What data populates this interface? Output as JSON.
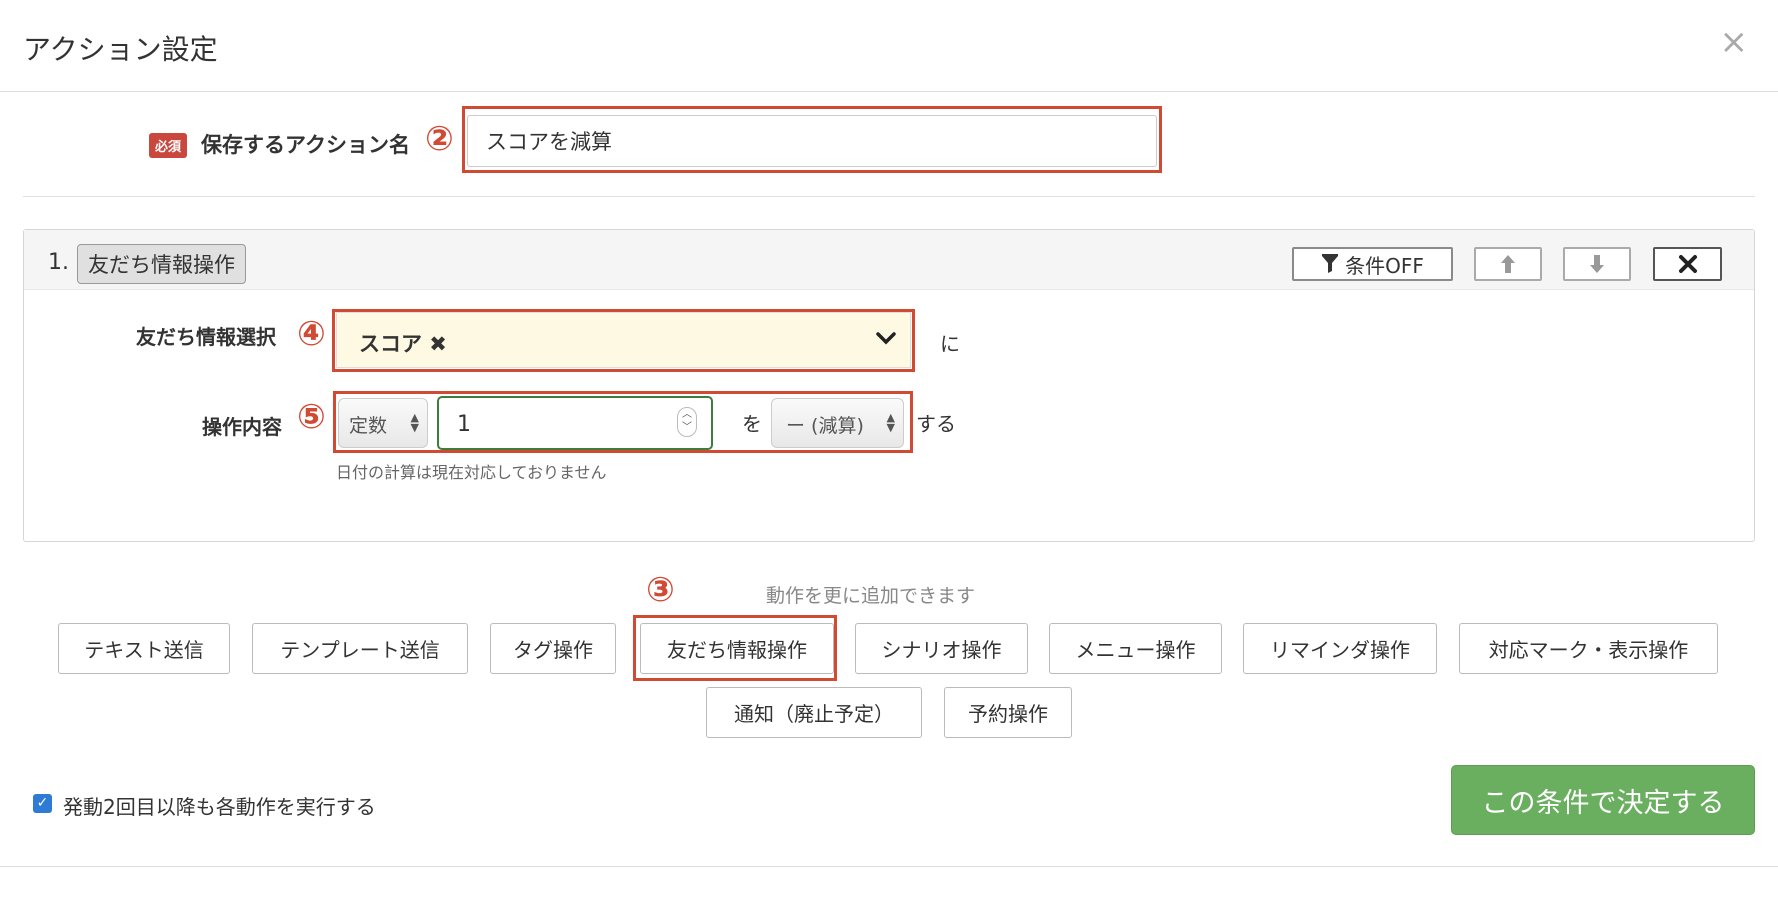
{
  "header": {
    "title": "アクション設定",
    "close_icon": "×"
  },
  "name_field": {
    "required_badge": "必須",
    "label": "保存するアクション名",
    "marker": "②",
    "value": "スコアを減算"
  },
  "action": {
    "index": "1.",
    "type_tag": "友だち情報操作",
    "condition_button": "条件OFF",
    "friend_info": {
      "label": "友だち情報選択",
      "marker": "④",
      "selected": "スコア ✖",
      "suffix": "に"
    },
    "operation": {
      "label": "操作内容",
      "marker": "⑤",
      "value_type": "定数",
      "value": "1",
      "particle": "を",
      "operator": "ー (減算)",
      "suffix": "する",
      "note": "日付の計算は現在対応しておりません"
    }
  },
  "add_actions": {
    "marker": "③",
    "hint": "動作を更に追加できます",
    "buttons": [
      "テキスト送信",
      "テンプレート送信",
      "タグ操作",
      "友だち情報操作",
      "シナリオ操作",
      "メニュー操作",
      "リマインダ操作",
      "対応マーク・表示操作",
      "通知（廃止予定）",
      "予約操作"
    ]
  },
  "footer": {
    "repeat_checked": true,
    "repeat_label": "発動2回目以降も各動作を実行する",
    "submit_label": "この条件で決定する"
  },
  "colors": {
    "highlight_red": "#d14a34",
    "submit_green": "#6aaf5f",
    "select_bg": "#fdf9e3",
    "required_badge": "#c9473c"
  }
}
